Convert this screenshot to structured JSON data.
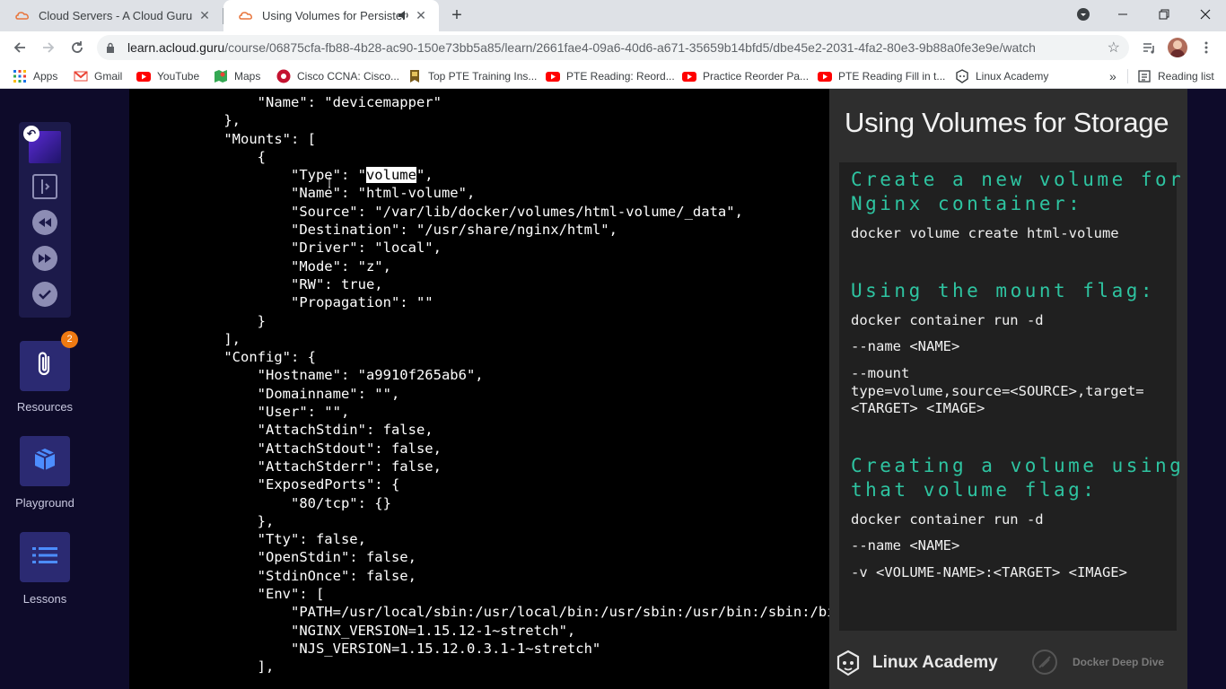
{
  "browser": {
    "tabs": [
      {
        "title": "Cloud Servers - A Cloud Guru",
        "active": false
      },
      {
        "title": "Using Volumes for Persistent",
        "active": true
      }
    ],
    "new_tab_label": "+",
    "url_host": "learn.acloud.guru",
    "url_path": "/course/06875cfa-fb88-4b28-ac90-150e73bb5a85/learn/2661fae4-09a6-40d6-a671-35659b14bfd5/dbe45e2-2031-4fa2-80e3-9b88a0fe3e9e/watch",
    "bookmarks": [
      {
        "label": "Apps",
        "icon": "apps-grid-icon"
      },
      {
        "label": "Gmail",
        "icon": "gmail-icon"
      },
      {
        "label": "YouTube",
        "icon": "youtube-icon"
      },
      {
        "label": "Maps",
        "icon": "maps-icon"
      },
      {
        "label": "Cisco CCNA: Cisco...",
        "icon": "cisco-icon"
      },
      {
        "label": "Top PTE Training Ins...",
        "icon": "pte-icon"
      },
      {
        "label": "PTE Reading: Reord...",
        "icon": "youtube-icon"
      },
      {
        "label": "Practice Reorder Pa...",
        "icon": "youtube-icon"
      },
      {
        "label": "PTE Reading Fill in t...",
        "icon": "youtube-icon"
      },
      {
        "label": "Linux Academy",
        "icon": "linux-academy-icon"
      }
    ],
    "more_bookmarks": "»",
    "reading_list": "Reading list"
  },
  "sidebar": {
    "resources_label": "Resources",
    "resources_badge": "2",
    "playground_label": "Playground",
    "lessons_label": "Lessons"
  },
  "terminal": {
    "lines": [
      "        \"Name\": \"devicemapper\"",
      "    },",
      "    \"Mounts\": [",
      "        {",
      "            \"Type\": \"",
      "            \"Name\": \"html-volume\",",
      "            \"Source\": \"/var/lib/docker/volumes/html-volume/_data\",",
      "            \"Destination\": \"/usr/share/nginx/html\",",
      "            \"Driver\": \"local\",",
      "            \"Mode\": \"z\",",
      "            \"RW\": true,",
      "            \"Propagation\": \"\"",
      "        }",
      "    ],",
      "    \"Config\": {",
      "        \"Hostname\": \"a9910f265ab6\",",
      "        \"Domainname\": \"\",",
      "        \"User\": \"\",",
      "        \"AttachStdin\": false,",
      "        \"AttachStdout\": false,",
      "        \"AttachStderr\": false,",
      "        \"ExposedPorts\": {",
      "            \"80/tcp\": {}",
      "        },",
      "        \"Tty\": false,",
      "        \"OpenStdin\": false,",
      "        \"StdinOnce\": false,",
      "        \"Env\": [",
      "            \"PATH=/usr/local/sbin:/usr/local/bin:/usr/sbin:/usr/bin:/sbin:/bin\",",
      "            \"NGINX_VERSION=1.15.12-1~stretch\",",
      "            \"NJS_VERSION=1.15.12.0.3.1-1~stretch\"",
      "        ],"
    ],
    "highlight_word": "volume",
    "highlight_suffix": "\","
  },
  "slide": {
    "title": "Using Volumes for Storage",
    "sections": [
      {
        "heading": "Create a new volume for a\nNginx container:",
        "commands": [
          "docker volume create html-volume"
        ]
      },
      {
        "heading": "Using the mount flag:",
        "commands": [
          "docker container run -d",
          "--name <NAME>",
          "--mount\ntype=volume,source=<SOURCE>,target=\n<TARGET> <IMAGE>"
        ]
      },
      {
        "heading": "Creating a volume using\nthat volume flag:",
        "commands": [
          "docker container run -d",
          "--name <NAME>",
          "-v <VOLUME-NAME>:<TARGET> <IMAGE>"
        ]
      }
    ],
    "brand": "Linux Academy",
    "course": "Docker Deep Dive"
  },
  "colors": {
    "page_bg": "#0e0b2a",
    "accent_heading": "#2ec4a1",
    "badge": "#ef7a12"
  }
}
